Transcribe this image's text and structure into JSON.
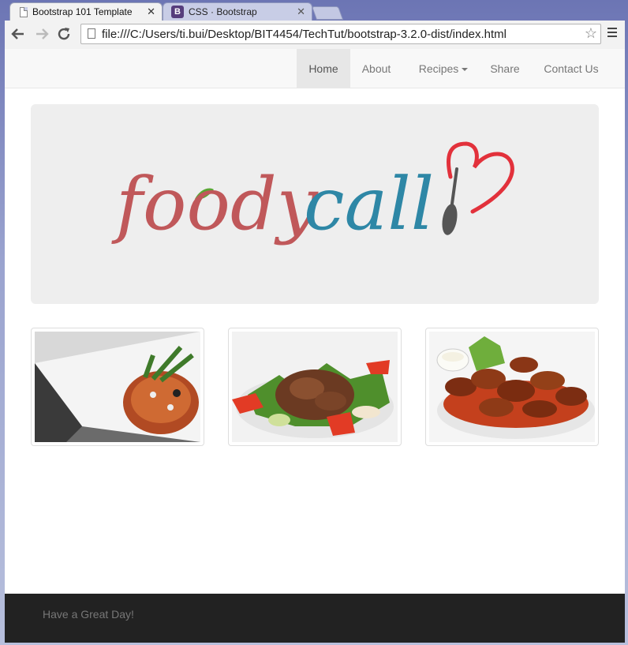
{
  "browser": {
    "tabs": [
      {
        "title": "Bootstrap 101 Template",
        "active": true
      },
      {
        "title": "CSS · Bootstrap",
        "active": false
      }
    ],
    "url": "file:///C:/Users/ti.bui/Desktop/BIT4454/TechTut/bootstrap-3.2.0-dist/index.html"
  },
  "navbar": {
    "items": [
      {
        "label": "Home",
        "active": true
      },
      {
        "label": "About"
      },
      {
        "label": "Recipes",
        "dropdown": true
      },
      {
        "label": "Share"
      },
      {
        "label": "Contact Us"
      }
    ]
  },
  "logo": {
    "part1": "foody",
    "part2": "call",
    "colors": {
      "part1": "#c0585a",
      "part2": "#2e87a6",
      "heart": "#e2313b",
      "spoon": "#555555",
      "leaf": "#5aa634"
    }
  },
  "thumbnails": [
    {
      "name": "spaghetti"
    },
    {
      "name": "beef-salad"
    },
    {
      "name": "chicken-wings"
    }
  ],
  "footer": {
    "text": "Have a Great Day!"
  },
  "colors": {
    "navbar_bg": "#f8f8f8",
    "jumbotron_bg": "#eeeeee",
    "footer_bg": "#222222"
  }
}
